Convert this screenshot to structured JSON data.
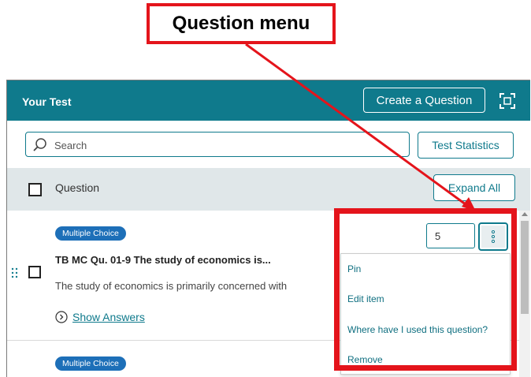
{
  "callout": {
    "label": "Question menu"
  },
  "header": {
    "title": "Your Test",
    "create_label": "Create a Question",
    "fullscreen_icon": "fullscreen-icon"
  },
  "search": {
    "placeholder": "Search",
    "value": ""
  },
  "toolbar": {
    "stats_label": "Test Statistics"
  },
  "columns": {
    "question_label": "Question",
    "expand_label": "Expand All"
  },
  "items": [
    {
      "type": "Multiple Choice",
      "title": "TB MC Qu. 01-9 The study of economics is...",
      "description": "The study of economics is primarily concerned with",
      "show_answers_label": "Show Answers",
      "points": "5"
    },
    {
      "type": "Multiple Choice"
    }
  ],
  "menu": {
    "items": [
      "Pin",
      "Edit item",
      "Where have I used this question?",
      "Remove"
    ]
  },
  "colors": {
    "header": "#0f7a8c",
    "accent": "#0f7a8c",
    "badge": "#1d6fb8",
    "highlight": "#e4141b"
  }
}
